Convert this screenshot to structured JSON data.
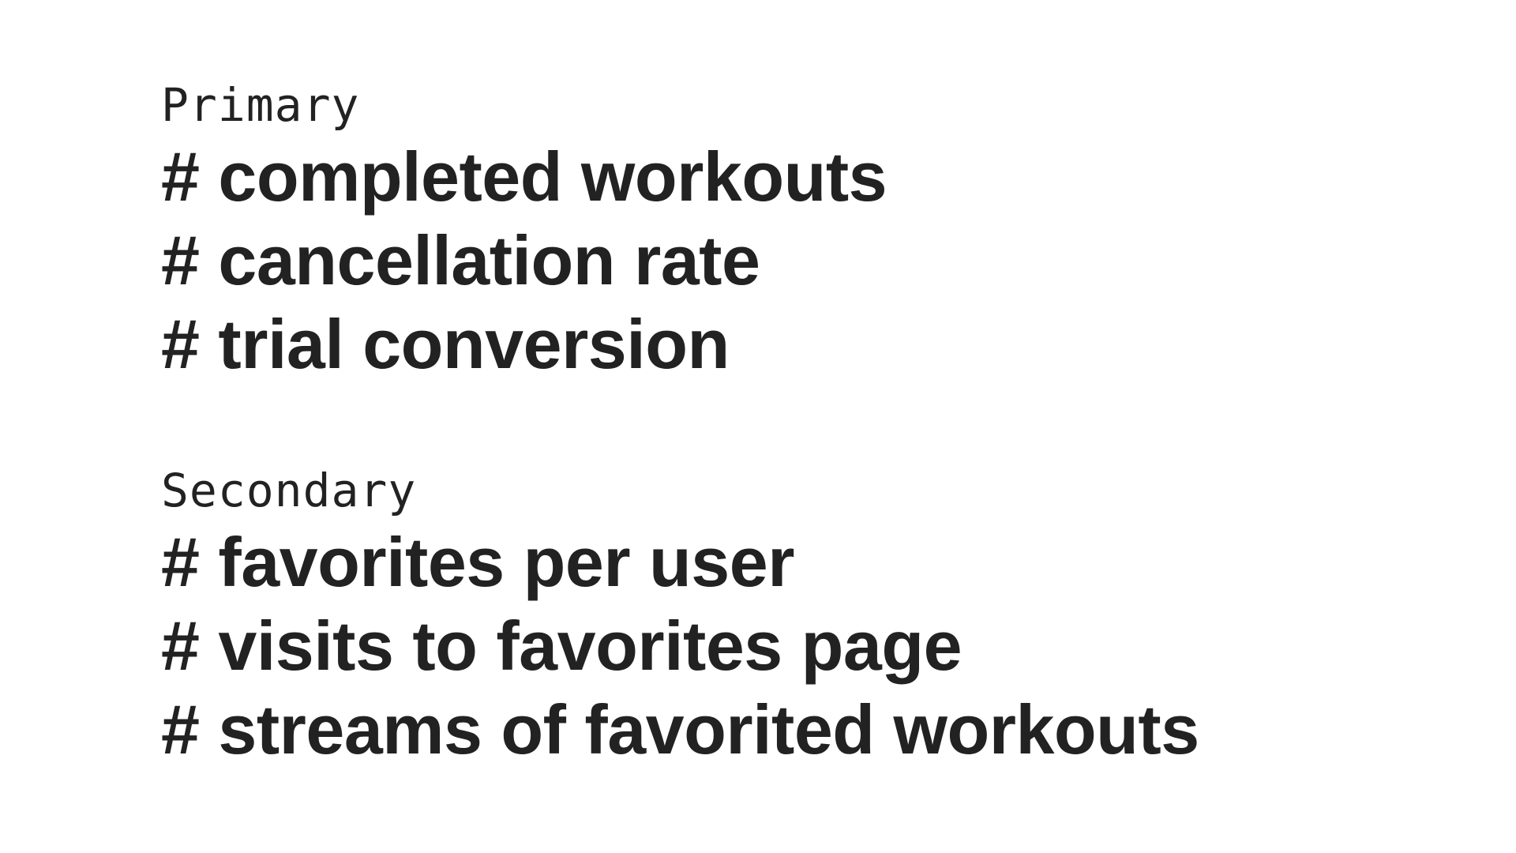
{
  "sections": [
    {
      "label": "Primary",
      "metrics": [
        "# completed workouts",
        "# cancellation rate",
        "# trial conversion"
      ]
    },
    {
      "label": "Secondary",
      "metrics": [
        "# favorites per user",
        "# visits to favorites page",
        "# streams of favorited workouts"
      ]
    }
  ],
  "colors": {
    "text": "#222222",
    "background": "#ffffff"
  }
}
